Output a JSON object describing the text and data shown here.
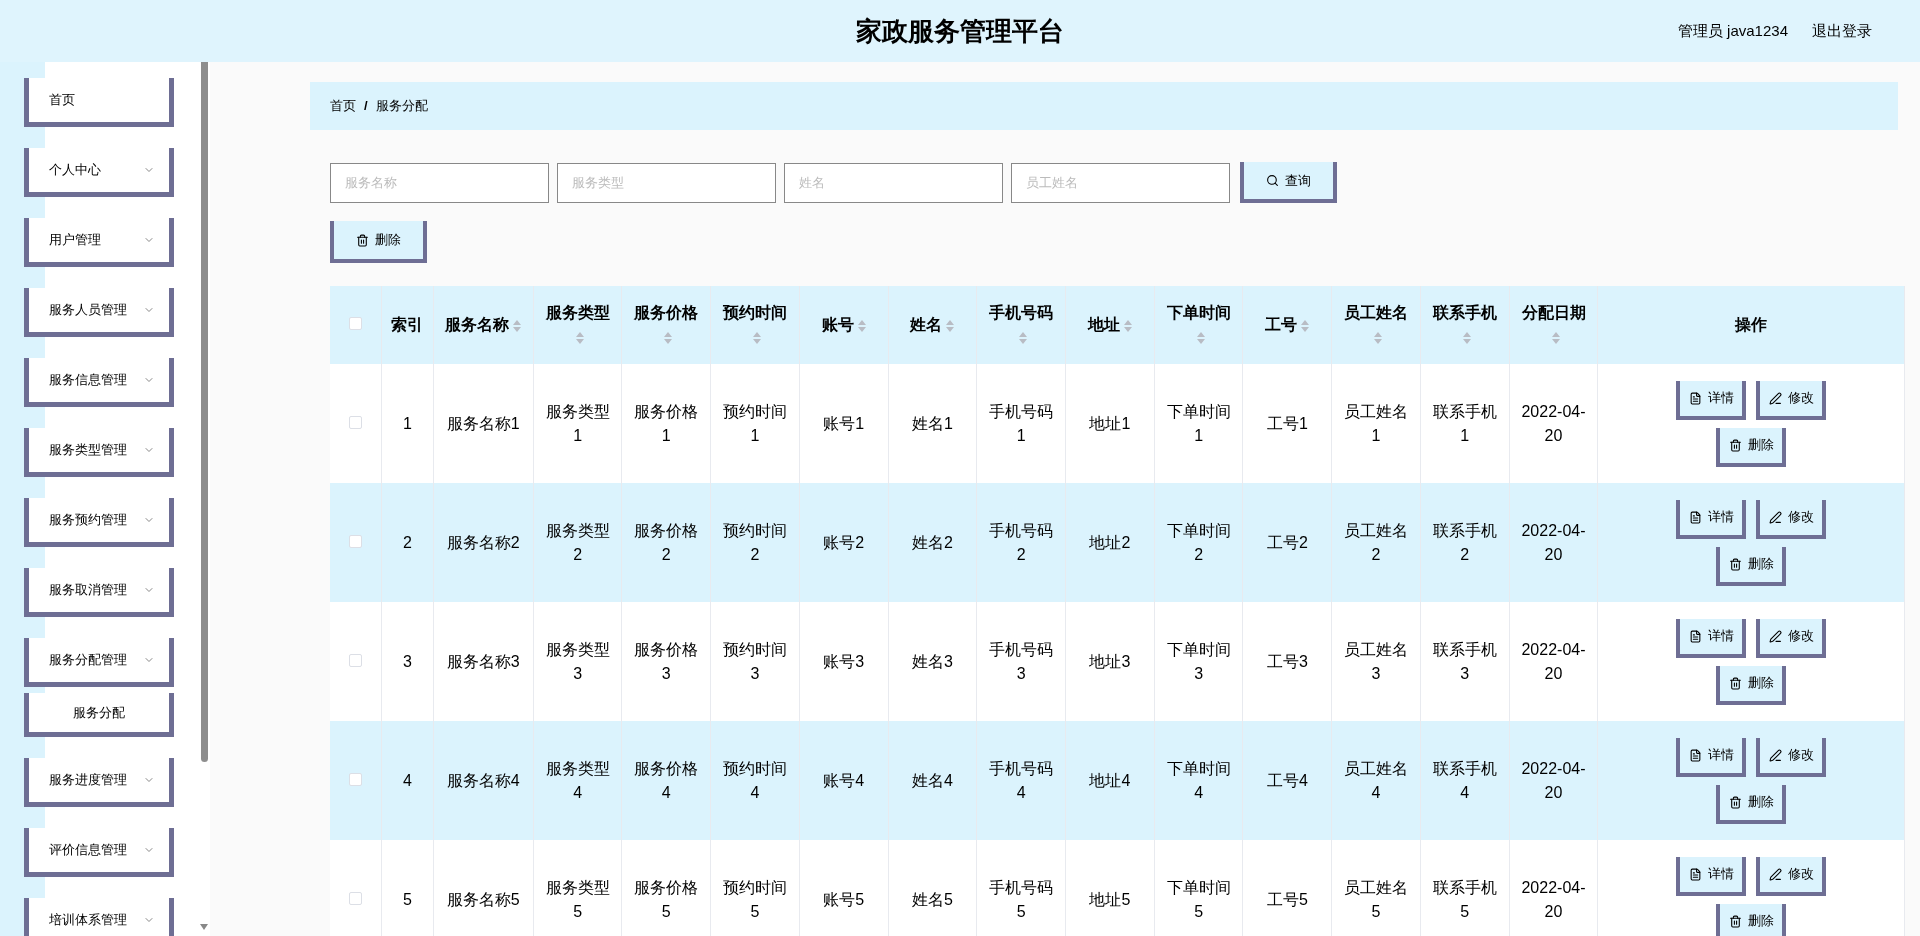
{
  "header": {
    "title": "家政服务管理平台",
    "user": "管理员 java1234",
    "logout": "退出登录"
  },
  "sidebar": {
    "items": [
      {
        "label": "首页",
        "kind": "link"
      },
      {
        "label": "个人中心",
        "kind": "menu"
      },
      {
        "label": "用户管理",
        "kind": "menu"
      },
      {
        "label": "服务人员管理",
        "kind": "menu"
      },
      {
        "label": "服务信息管理",
        "kind": "menu"
      },
      {
        "label": "服务类型管理",
        "kind": "menu"
      },
      {
        "label": "服务预约管理",
        "kind": "menu"
      },
      {
        "label": "服务取消管理",
        "kind": "menu"
      },
      {
        "label": "服务分配管理",
        "kind": "menu",
        "children": [
          {
            "label": "服务分配"
          }
        ]
      },
      {
        "label": "服务进度管理",
        "kind": "menu"
      },
      {
        "label": "评价信息管理",
        "kind": "menu"
      },
      {
        "label": "培训体系管理",
        "kind": "menu"
      }
    ]
  },
  "breadcrumb": [
    "首页",
    "/",
    "服务分配"
  ],
  "search": {
    "fields": [
      {
        "placeholder": "服务名称"
      },
      {
        "placeholder": "服务类型"
      },
      {
        "placeholder": "姓名"
      },
      {
        "placeholder": "员工姓名"
      }
    ],
    "button": "查询"
  },
  "toolbar": {
    "delete": "删除"
  },
  "table": {
    "select_all": {
      "checked": false
    },
    "columns": [
      {
        "label": "索引",
        "sortable": false
      },
      {
        "label": "服务名称",
        "sortable": true
      },
      {
        "label": "服务类型",
        "sortable": true
      },
      {
        "label": "服务价格",
        "sortable": true
      },
      {
        "label": "预约时间",
        "sortable": true
      },
      {
        "label": "账号",
        "sortable": true
      },
      {
        "label": "姓名",
        "sortable": true
      },
      {
        "label": "手机号码",
        "sortable": true
      },
      {
        "label": "地址",
        "sortable": true
      },
      {
        "label": "下单时间",
        "sortable": true
      },
      {
        "label": "工号",
        "sortable": true
      },
      {
        "label": "员工姓名",
        "sortable": true
      },
      {
        "label": "联系手机",
        "sortable": true
      },
      {
        "label": "分配日期",
        "sortable": true
      },
      {
        "label": "操作",
        "sortable": false
      }
    ],
    "rows": [
      {
        "checked": false,
        "cells": [
          "1",
          "服务名称1",
          "服务类型1",
          "服务价格1",
          "预约时间1",
          "账号1",
          "姓名1",
          "手机号码1",
          "地址1",
          "下单时间1",
          "工号1",
          "员工姓名1",
          "联系手机1",
          "2022-04-20"
        ],
        "actions": [
          {
            "kind": "detail",
            "label": "详情"
          },
          {
            "kind": "edit",
            "label": "修改"
          },
          {
            "kind": "delete",
            "label": "删除"
          }
        ]
      },
      {
        "checked": false,
        "cells": [
          "2",
          "服务名称2",
          "服务类型2",
          "服务价格2",
          "预约时间2",
          "账号2",
          "姓名2",
          "手机号码2",
          "地址2",
          "下单时间2",
          "工号2",
          "员工姓名2",
          "联系手机2",
          "2022-04-20"
        ],
        "actions": [
          {
            "kind": "detail",
            "label": "详情"
          },
          {
            "kind": "edit",
            "label": "修改"
          },
          {
            "kind": "delete",
            "label": "删除"
          }
        ]
      },
      {
        "checked": false,
        "cells": [
          "3",
          "服务名称3",
          "服务类型3",
          "服务价格3",
          "预约时间3",
          "账号3",
          "姓名3",
          "手机号码3",
          "地址3",
          "下单时间3",
          "工号3",
          "员工姓名3",
          "联系手机3",
          "2022-04-20"
        ],
        "actions": [
          {
            "kind": "detail",
            "label": "详情"
          },
          {
            "kind": "edit",
            "label": "修改"
          },
          {
            "kind": "delete",
            "label": "删除"
          }
        ]
      },
      {
        "checked": false,
        "cells": [
          "4",
          "服务名称4",
          "服务类型4",
          "服务价格4",
          "预约时间4",
          "账号4",
          "姓名4",
          "手机号码4",
          "地址4",
          "下单时间4",
          "工号4",
          "员工姓名4",
          "联系手机4",
          "2022-04-20"
        ],
        "actions": [
          {
            "kind": "detail",
            "label": "详情"
          },
          {
            "kind": "edit",
            "label": "修改"
          },
          {
            "kind": "delete",
            "label": "删除"
          }
        ]
      },
      {
        "checked": false,
        "cells": [
          "5",
          "服务名称5",
          "服务类型5",
          "服务价格5",
          "预约时间5",
          "账号5",
          "姓名5",
          "手机号码5",
          "地址5",
          "下单时间5",
          "工号5",
          "员工姓名5",
          "联系手机5",
          "2022-04-20"
        ],
        "actions": [
          {
            "kind": "detail",
            "label": "详情"
          },
          {
            "kind": "edit",
            "label": "修改"
          },
          {
            "kind": "delete",
            "label": "删除"
          }
        ]
      }
    ]
  }
}
